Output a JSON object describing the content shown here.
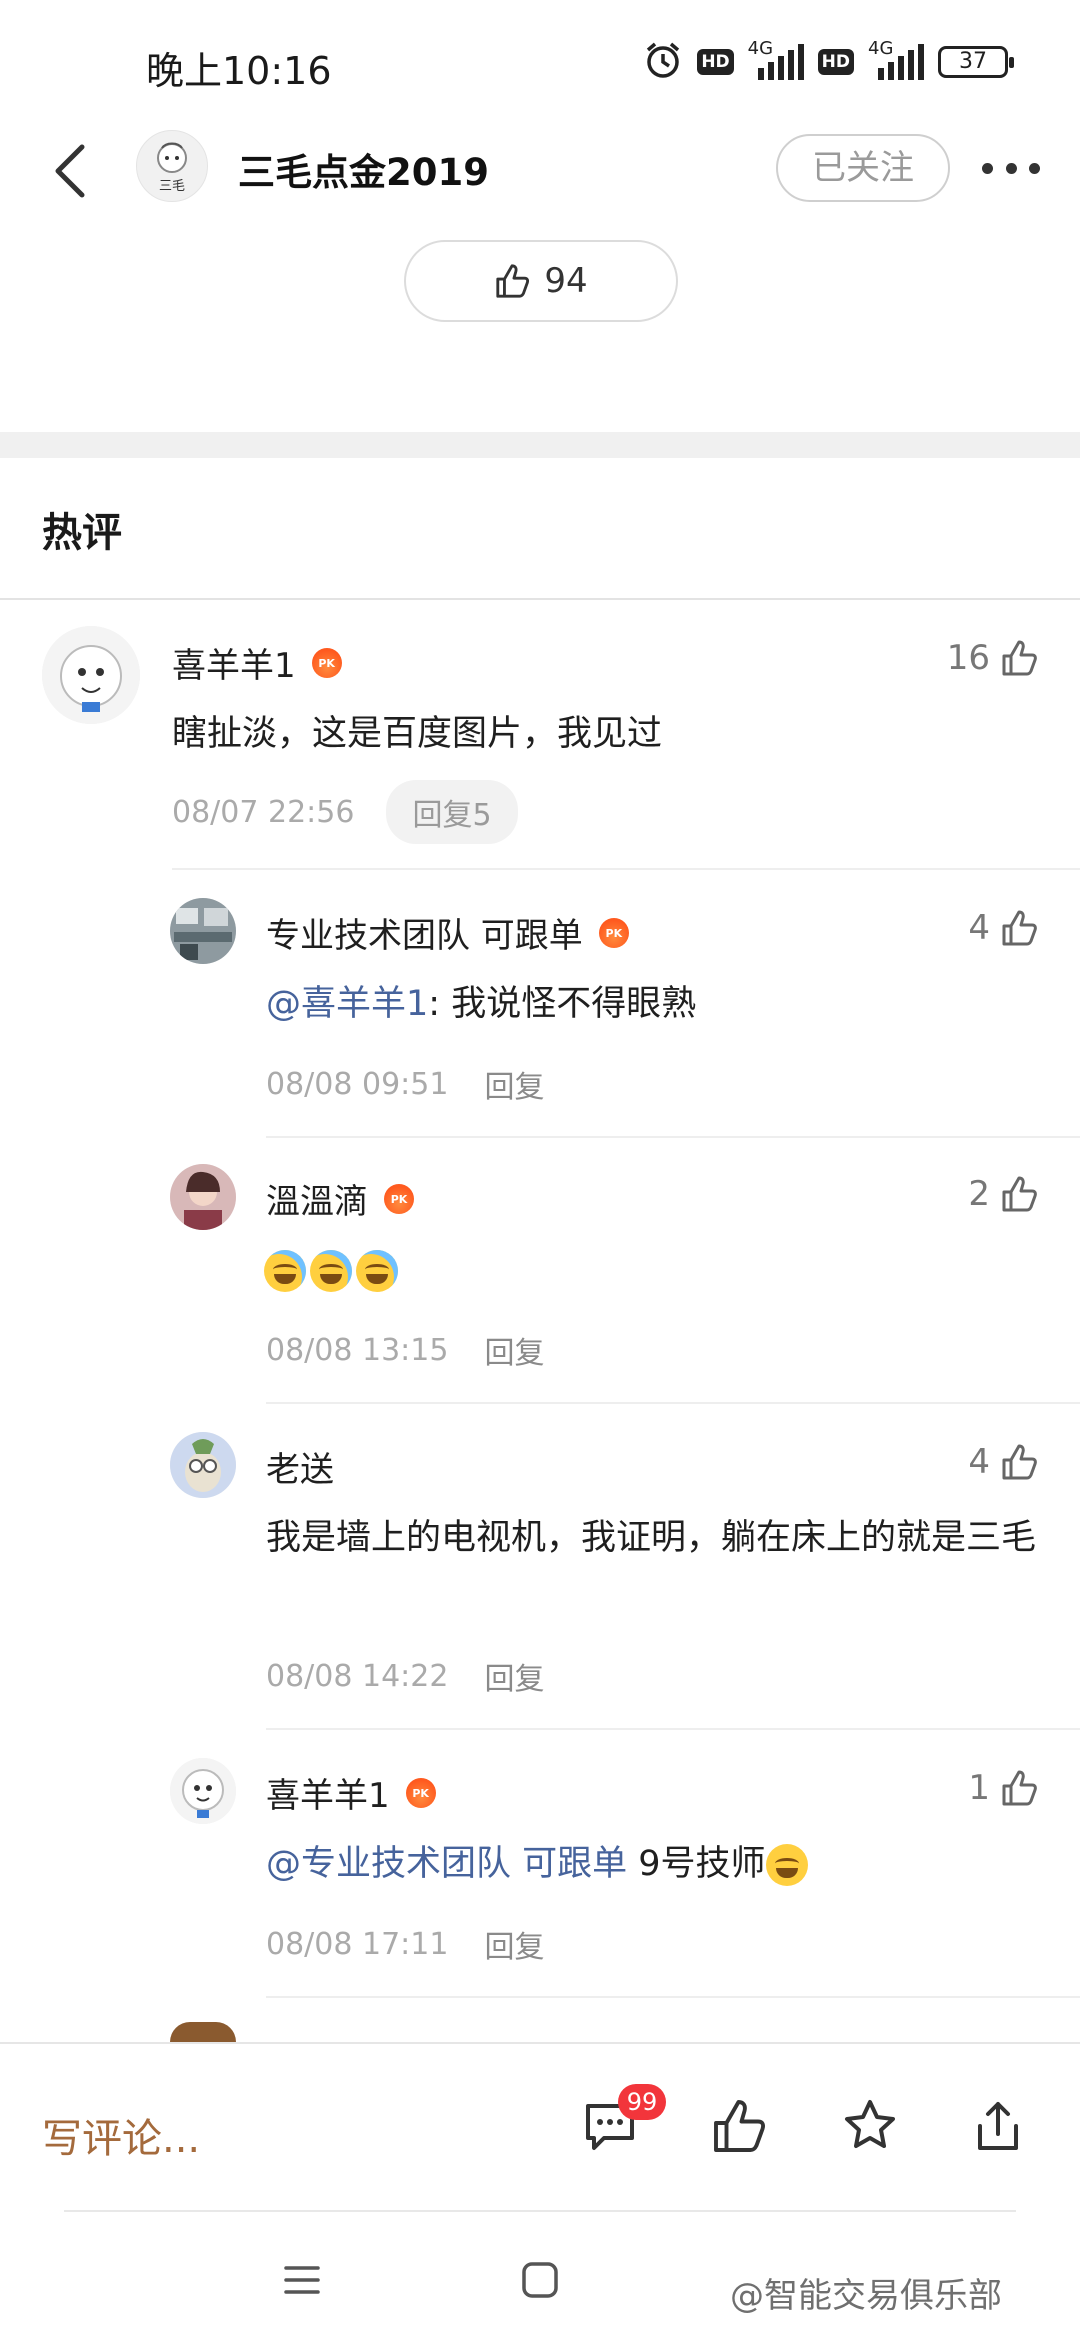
{
  "status_bar": {
    "time": "晚上10:16",
    "hd1": "HD",
    "hd2": "HD",
    "net1": "4G",
    "net2": "4G",
    "battery": "37"
  },
  "header": {
    "account_name": "三毛点金2019",
    "avatar_text": "三毛",
    "follow_label": "已关注"
  },
  "article": {
    "like_count": "94"
  },
  "section": {
    "title": "热评"
  },
  "comments": [
    {
      "user": "喜羊羊1",
      "likes": "16",
      "text": "瞎扯淡，这是百度图片，我见过",
      "time": "08/07 22:56",
      "reply": "回复5"
    },
    {
      "user": "专业技术团队 可跟单",
      "likes": "4",
      "mention": "@喜羊羊1",
      "text": ": 我说怪不得眼熟",
      "time": "08/08 09:51",
      "reply": "回复"
    },
    {
      "user": "溫溫滴",
      "likes": "2",
      "text": "",
      "time": "08/08 13:15",
      "reply": "回复"
    },
    {
      "user": "老送",
      "likes": "4",
      "text": "我是墙上的电视机，我证明，躺在床上的就是三毛",
      "time": "08/08 14:22",
      "reply": "回复"
    },
    {
      "user": "喜羊羊1",
      "likes": "1",
      "mention": "@专业技术团队 可跟单",
      "text": " 9号技师",
      "time": "08/08 17:11",
      "reply": "回复"
    }
  ],
  "pk_badge": "PK",
  "bottom_bar": {
    "write_comment": "写评论...",
    "comment_badge": "99"
  },
  "watermark": "@智能交易俱乐部",
  "colors": {
    "mention": "#46639c",
    "write_comment": "#a46a3c",
    "badge": "#f2353b",
    "pk": "#ff5a1f"
  }
}
